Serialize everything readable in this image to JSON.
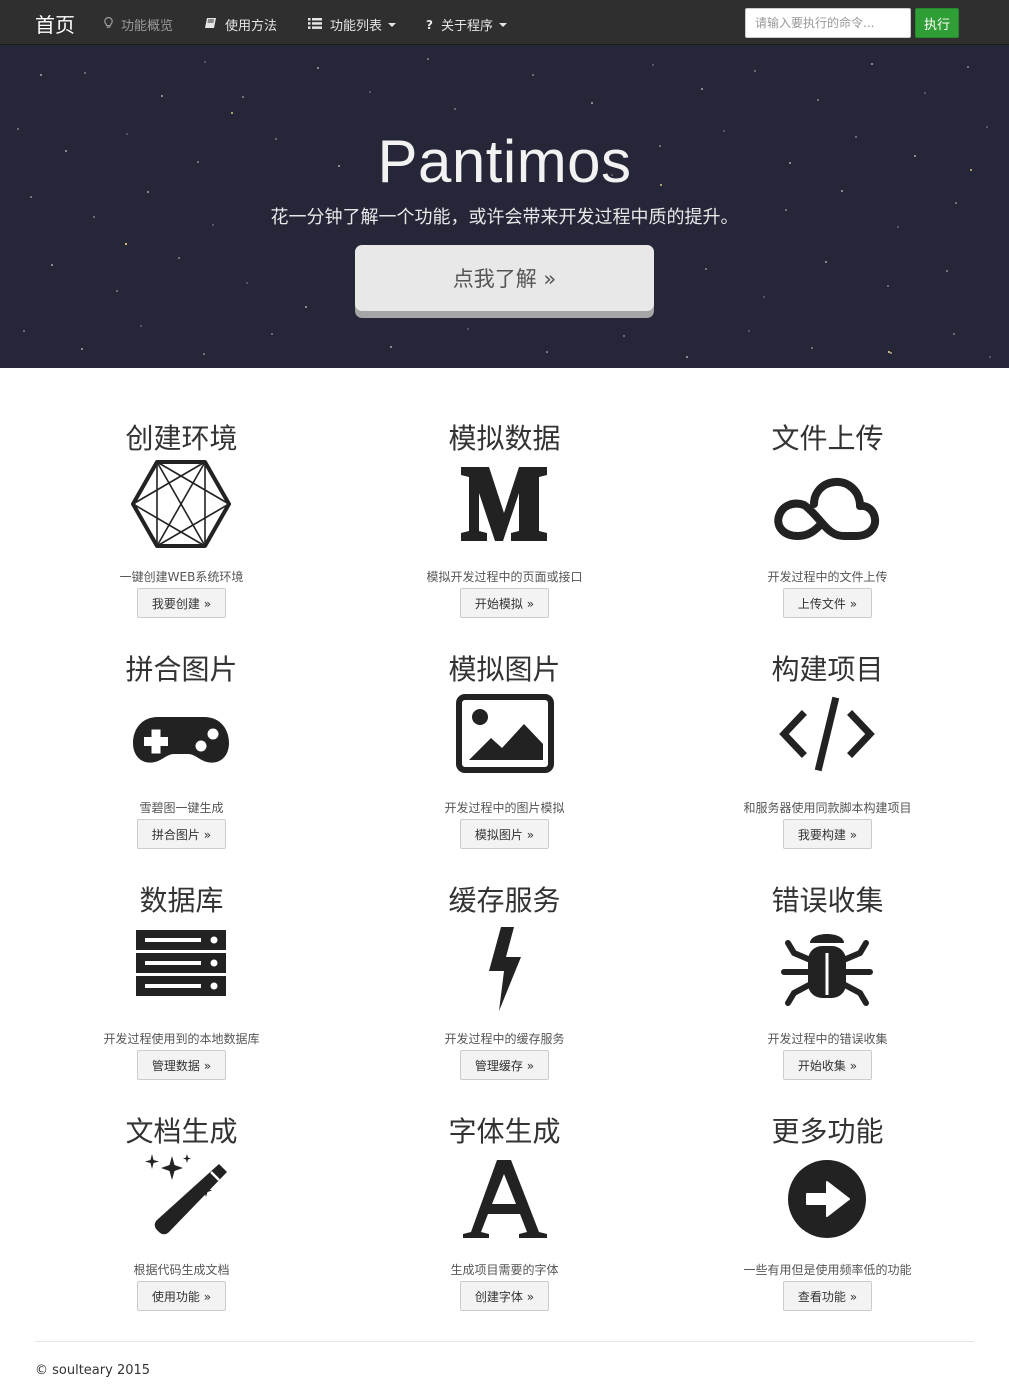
{
  "navbar": {
    "brand": "首页",
    "items": [
      {
        "label": "功能概览",
        "icon": "lightbulb-icon",
        "muted": true
      },
      {
        "label": "使用方法",
        "icon": "book-icon",
        "muted": false
      },
      {
        "label": "功能列表",
        "icon": "list-icon",
        "dropdown": true
      },
      {
        "label": "关于程序",
        "icon": "question-icon",
        "dropdown": true
      }
    ],
    "command_placeholder": "请输入要执行的命令...",
    "run_label": "执行"
  },
  "hero": {
    "title": "Pantimos",
    "subtitle": "花一分钟了解一个功能，或许会带来开发过程中质的提升。",
    "button_label": "点我了解 »"
  },
  "features": [
    {
      "title": "创建环境",
      "icon": "hexagon-network-icon",
      "desc": "一键创建WEB系统环境",
      "button": "我要创建 »"
    },
    {
      "title": "模拟数据",
      "icon": "medium-m-icon",
      "desc": "模拟开发过程中的页面或接口",
      "button": "开始模拟 »"
    },
    {
      "title": "文件上传",
      "icon": "cloud-icon",
      "desc": "开发过程中的文件上传",
      "button": "上传文件 »"
    },
    {
      "title": "拼合图片",
      "icon": "gamepad-icon",
      "desc": "雪碧图一键生成",
      "button": "拼合图片 »"
    },
    {
      "title": "模拟图片",
      "icon": "image-icon",
      "desc": "开发过程中的图片模拟",
      "button": "模拟图片 »"
    },
    {
      "title": "构建项目",
      "icon": "code-icon",
      "desc": "和服务器使用同款脚本构建项目",
      "button": "我要构建 »"
    },
    {
      "title": "数据库",
      "icon": "server-icon",
      "desc": "开发过程使用到的本地数据库",
      "button": "管理数据 »"
    },
    {
      "title": "缓存服务",
      "icon": "bolt-icon",
      "desc": "开发过程中的缓存服务",
      "button": "管理缓存 »"
    },
    {
      "title": "错误收集",
      "icon": "bug-icon",
      "desc": "开发过程中的错误收集",
      "button": "开始收集 »"
    },
    {
      "title": "文档生成",
      "icon": "magic-wand-icon",
      "desc": "根据代码生成文档",
      "button": "使用功能 »"
    },
    {
      "title": "字体生成",
      "icon": "font-a-icon",
      "desc": "生成项目需要的字体",
      "button": "创建字体 »"
    },
    {
      "title": "更多功能",
      "icon": "arrow-circle-right-icon",
      "desc": "一些有用但是使用频率低的功能",
      "button": "查看功能 »"
    }
  ],
  "footer": {
    "copyright": "© soulteary 2015"
  },
  "colors": {
    "navbar": "#2f2f2f",
    "hero": "#252638",
    "run_button": "#2f9e36",
    "icon": "#222222"
  }
}
